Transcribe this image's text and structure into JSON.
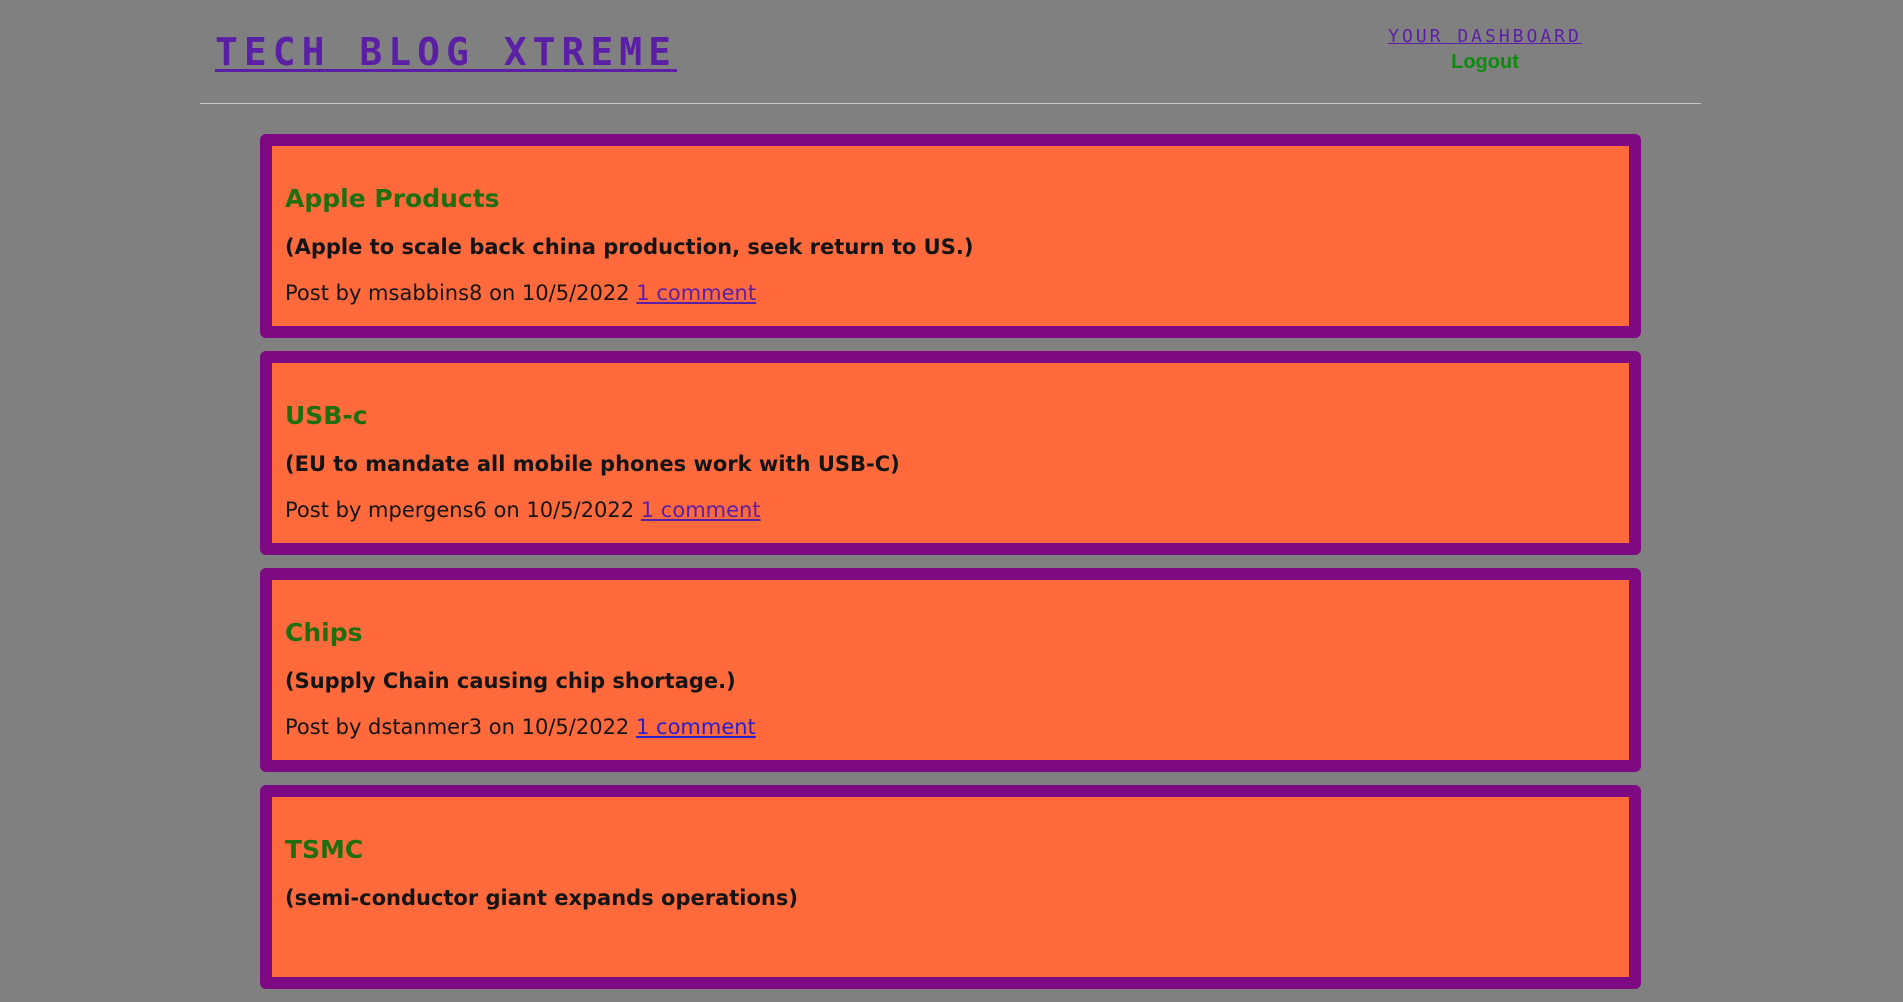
{
  "header": {
    "site_title": "TECH BLOG XTREME",
    "nav_dashboard": "YOUR DASHBOARD",
    "nav_logout": "Logout"
  },
  "posts": [
    {
      "title": "Apple Products",
      "summary": "(Apple to scale back china production, seek return to US.)",
      "meta_prefix": "Post by msabbins8 on 10/5/2022",
      "comments": "1 comment"
    },
    {
      "title": "USB-c",
      "summary": "(EU to mandate all mobile phones work with USB-C)",
      "meta_prefix": "Post by mpergens6 on 10/5/2022",
      "comments": "1 comment"
    },
    {
      "title": "Chips",
      "summary": "(Supply Chain causing chip shortage.)",
      "meta_prefix": "Post by dstanmer3 on 10/5/2022",
      "comments": "1 comment"
    },
    {
      "title": "TSMC",
      "summary": "(semi-conductor giant expands operations)",
      "meta_prefix": "",
      "comments": ""
    }
  ],
  "colors": {
    "background": "#808080",
    "card_border": "#7d0a82",
    "card_fill": "#ff6a3c",
    "title_green": "#1f6f10",
    "brand_purple": "#5b1fa6",
    "logout_green": "#0e8a0e"
  }
}
